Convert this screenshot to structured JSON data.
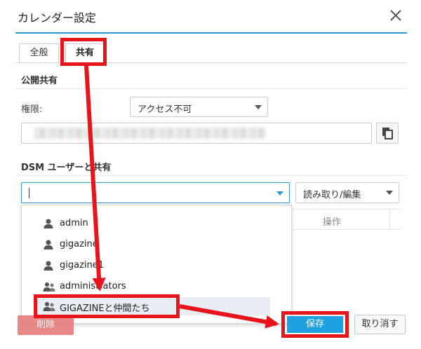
{
  "dialog": {
    "title": "カレンダー設定"
  },
  "tabs": [
    {
      "label": "全般"
    },
    {
      "label": "共有"
    }
  ],
  "public_share": {
    "heading": "公開共有",
    "permission_label": "権限:",
    "permission_value": "アクセス不可"
  },
  "dsm_share": {
    "heading": "DSM ユーザーと共有",
    "user_input_value": "",
    "permission_value": "読み取り/編集",
    "column_operation": "操作",
    "dropdown_items": [
      {
        "label": "admin",
        "icon": "user-icon"
      },
      {
        "label": "gigazine",
        "icon": "user-icon"
      },
      {
        "label": "gigazine1",
        "icon": "user-icon"
      },
      {
        "label": "administrators",
        "icon": "group-icon"
      },
      {
        "label": "GIGAZINEと仲間たち",
        "icon": "group-icon"
      }
    ]
  },
  "footer": {
    "delete_label": "削除",
    "save_label": "保存",
    "cancel_label": "取り消す"
  },
  "colors": {
    "accent": "#2c9ad4",
    "highlight": "#e8141c",
    "save": "#1fa0e0"
  }
}
